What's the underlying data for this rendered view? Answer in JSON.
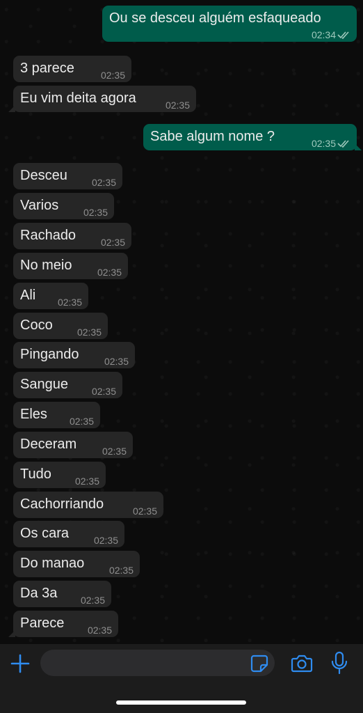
{
  "accent_color": "#2f8cf0",
  "messages": [
    {
      "text": "Ou se desceu alguém esfaqueado",
      "time": "02:34",
      "dir": "out"
    },
    {
      "text": "3 parece",
      "time": "02:35",
      "dir": "in"
    },
    {
      "text": "Eu vim deita agora",
      "time": "02:35",
      "dir": "in"
    },
    {
      "text": "Sabe algum nome ?",
      "time": "02:35",
      "dir": "out"
    },
    {
      "text": "Desceu",
      "time": "02:35",
      "dir": "in"
    },
    {
      "text": "Varios",
      "time": "02:35",
      "dir": "in"
    },
    {
      "text": "Rachado",
      "time": "02:35",
      "dir": "in"
    },
    {
      "text": "No meio",
      "time": "02:35",
      "dir": "in"
    },
    {
      "text": "Ali",
      "time": "02:35",
      "dir": "in"
    },
    {
      "text": "Coco",
      "time": "02:35",
      "dir": "in"
    },
    {
      "text": "Pingando",
      "time": "02:35",
      "dir": "in"
    },
    {
      "text": "Sangue",
      "time": "02:35",
      "dir": "in"
    },
    {
      "text": "Eles",
      "time": "02:35",
      "dir": "in"
    },
    {
      "text": "Deceram",
      "time": "02:35",
      "dir": "in"
    },
    {
      "text": "Tudo",
      "time": "02:35",
      "dir": "in"
    },
    {
      "text": "Cachorriando",
      "time": "02:35",
      "dir": "in"
    },
    {
      "text": "Os cara",
      "time": "02:35",
      "dir": "in"
    },
    {
      "text": "Do manao",
      "time": "02:35",
      "dir": "in"
    },
    {
      "text": "Da 3a",
      "time": "02:35",
      "dir": "in"
    },
    {
      "text": "Parece",
      "time": "02:35",
      "dir": "in"
    }
  ],
  "composer": {
    "input_value": "",
    "icons": [
      "plus-icon",
      "sticker-icon",
      "camera-icon",
      "microphone-icon"
    ]
  }
}
